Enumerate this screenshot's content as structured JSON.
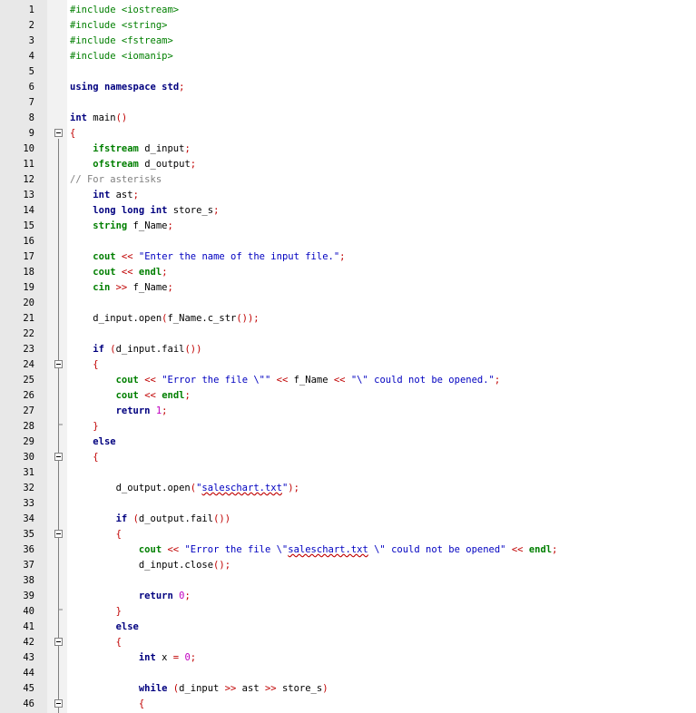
{
  "editor": {
    "lines": [
      {
        "n": "1",
        "fold": false,
        "tokens": [
          {
            "t": "#include <iostream>",
            "c": "pre"
          }
        ]
      },
      {
        "n": "2",
        "fold": false,
        "tokens": [
          {
            "t": "#include <string>",
            "c": "pre"
          }
        ]
      },
      {
        "n": "3",
        "fold": false,
        "tokens": [
          {
            "t": "#include <fstream>",
            "c": "pre"
          }
        ]
      },
      {
        "n": "4",
        "fold": false,
        "tokens": [
          {
            "t": "#include <iomanip>",
            "c": "pre"
          }
        ]
      },
      {
        "n": "5",
        "fold": false,
        "tokens": []
      },
      {
        "n": "6",
        "fold": false,
        "tokens": [
          {
            "t": "using",
            "c": "kw"
          },
          {
            "t": " "
          },
          {
            "t": "namespace",
            "c": "kw"
          },
          {
            "t": " "
          },
          {
            "t": "std",
            "c": "kw"
          },
          {
            "t": ";",
            "c": "op"
          }
        ]
      },
      {
        "n": "7",
        "fold": false,
        "tokens": []
      },
      {
        "n": "8",
        "fold": false,
        "tokens": [
          {
            "t": "int",
            "c": "kw"
          },
          {
            "t": " main"
          },
          {
            "t": "()",
            "c": "op"
          }
        ]
      },
      {
        "n": "9",
        "fold": true,
        "tokens": [
          {
            "t": "{",
            "c": "op"
          }
        ]
      },
      {
        "n": "10",
        "fold": false,
        "tokens": [
          {
            "t": "    "
          },
          {
            "t": "ifstream",
            "c": "green"
          },
          {
            "t": " d_input"
          },
          {
            "t": ";",
            "c": "op"
          }
        ]
      },
      {
        "n": "11",
        "fold": false,
        "tokens": [
          {
            "t": "    "
          },
          {
            "t": "ofstream",
            "c": "green"
          },
          {
            "t": " d_output"
          },
          {
            "t": ";",
            "c": "op"
          }
        ]
      },
      {
        "n": "12",
        "fold": false,
        "tokens": [
          {
            "t": "// For asterisks",
            "c": "cmt"
          }
        ]
      },
      {
        "n": "13",
        "fold": false,
        "tokens": [
          {
            "t": "    "
          },
          {
            "t": "int",
            "c": "kw"
          },
          {
            "t": " ast"
          },
          {
            "t": ";",
            "c": "op"
          }
        ]
      },
      {
        "n": "14",
        "fold": false,
        "tokens": [
          {
            "t": "    "
          },
          {
            "t": "long long int",
            "c": "kw"
          },
          {
            "t": " store_s"
          },
          {
            "t": ";",
            "c": "op"
          }
        ]
      },
      {
        "n": "15",
        "fold": false,
        "tokens": [
          {
            "t": "    "
          },
          {
            "t": "string",
            "c": "green"
          },
          {
            "t": " f_Name"
          },
          {
            "t": ";",
            "c": "op"
          }
        ]
      },
      {
        "n": "16",
        "fold": false,
        "tokens": []
      },
      {
        "n": "17",
        "fold": false,
        "tokens": [
          {
            "t": "    "
          },
          {
            "t": "cout",
            "c": "green"
          },
          {
            "t": " "
          },
          {
            "t": "<<",
            "c": "op"
          },
          {
            "t": " "
          },
          {
            "t": "\"Enter the name of the input file.\"",
            "c": "str"
          },
          {
            "t": ";",
            "c": "op"
          }
        ]
      },
      {
        "n": "18",
        "fold": false,
        "tokens": [
          {
            "t": "    "
          },
          {
            "t": "cout",
            "c": "green"
          },
          {
            "t": " "
          },
          {
            "t": "<<",
            "c": "op"
          },
          {
            "t": " "
          },
          {
            "t": "endl",
            "c": "green"
          },
          {
            "t": ";",
            "c": "op"
          }
        ]
      },
      {
        "n": "19",
        "fold": false,
        "tokens": [
          {
            "t": "    "
          },
          {
            "t": "cin",
            "c": "green"
          },
          {
            "t": " "
          },
          {
            "t": ">>",
            "c": "op"
          },
          {
            "t": " f_Name"
          },
          {
            "t": ";",
            "c": "op"
          }
        ]
      },
      {
        "n": "20",
        "fold": false,
        "tokens": []
      },
      {
        "n": "21",
        "fold": false,
        "tokens": [
          {
            "t": "    d_input.open"
          },
          {
            "t": "(",
            "c": "op"
          },
          {
            "t": "f_Name.c_str"
          },
          {
            "t": "());",
            "c": "op"
          }
        ]
      },
      {
        "n": "22",
        "fold": false,
        "tokens": []
      },
      {
        "n": "23",
        "fold": false,
        "tokens": [
          {
            "t": "    "
          },
          {
            "t": "if",
            "c": "kw"
          },
          {
            "t": " "
          },
          {
            "t": "(",
            "c": "op"
          },
          {
            "t": "d_input.fail"
          },
          {
            "t": "())",
            "c": "op"
          }
        ]
      },
      {
        "n": "24",
        "fold": true,
        "tokens": [
          {
            "t": "    "
          },
          {
            "t": "{",
            "c": "op"
          }
        ]
      },
      {
        "n": "25",
        "fold": false,
        "tokens": [
          {
            "t": "        "
          },
          {
            "t": "cout",
            "c": "green"
          },
          {
            "t": " "
          },
          {
            "t": "<<",
            "c": "op"
          },
          {
            "t": " "
          },
          {
            "t": "\"Error the file \\\"\"",
            "c": "str"
          },
          {
            "t": " "
          },
          {
            "t": "<<",
            "c": "op"
          },
          {
            "t": " f_Name "
          },
          {
            "t": "<<",
            "c": "op"
          },
          {
            "t": " "
          },
          {
            "t": "\"\\\" could not be opened.\"",
            "c": "str"
          },
          {
            "t": ";",
            "c": "op"
          }
        ]
      },
      {
        "n": "26",
        "fold": false,
        "tokens": [
          {
            "t": "        "
          },
          {
            "t": "cout",
            "c": "green"
          },
          {
            "t": " "
          },
          {
            "t": "<<",
            "c": "op"
          },
          {
            "t": " "
          },
          {
            "t": "endl",
            "c": "green"
          },
          {
            "t": ";",
            "c": "op"
          }
        ]
      },
      {
        "n": "27",
        "fold": false,
        "tokens": [
          {
            "t": "        "
          },
          {
            "t": "return",
            "c": "kw"
          },
          {
            "t": " "
          },
          {
            "t": "1",
            "c": "num"
          },
          {
            "t": ";",
            "c": "op"
          }
        ]
      },
      {
        "n": "28",
        "fold": false,
        "tokens": [
          {
            "t": "    "
          },
          {
            "t": "}",
            "c": "op"
          }
        ]
      },
      {
        "n": "29",
        "fold": false,
        "tokens": [
          {
            "t": "    "
          },
          {
            "t": "else",
            "c": "kw"
          }
        ]
      },
      {
        "n": "30",
        "fold": true,
        "tokens": [
          {
            "t": "    "
          },
          {
            "t": "{",
            "c": "op"
          }
        ]
      },
      {
        "n": "31",
        "fold": false,
        "tokens": []
      },
      {
        "n": "32",
        "fold": false,
        "tokens": [
          {
            "t": "        d_output.open"
          },
          {
            "t": "(",
            "c": "op"
          },
          {
            "t": "\"",
            "c": "str"
          },
          {
            "t": "saleschart.txt",
            "c": "str",
            "ul": true
          },
          {
            "t": "\"",
            "c": "str"
          },
          {
            "t": ");",
            "c": "op"
          }
        ]
      },
      {
        "n": "33",
        "fold": false,
        "tokens": []
      },
      {
        "n": "34",
        "fold": false,
        "tokens": [
          {
            "t": "        "
          },
          {
            "t": "if",
            "c": "kw"
          },
          {
            "t": " "
          },
          {
            "t": "(",
            "c": "op"
          },
          {
            "t": "d_output.fail"
          },
          {
            "t": "())",
            "c": "op"
          }
        ]
      },
      {
        "n": "35",
        "fold": true,
        "tokens": [
          {
            "t": "        "
          },
          {
            "t": "{",
            "c": "op"
          }
        ]
      },
      {
        "n": "36",
        "fold": false,
        "tokens": [
          {
            "t": "            "
          },
          {
            "t": "cout",
            "c": "green"
          },
          {
            "t": " "
          },
          {
            "t": "<<",
            "c": "op"
          },
          {
            "t": " "
          },
          {
            "t": "\"Error the file \\\"",
            "c": "str"
          },
          {
            "t": "saleschart.txt",
            "c": "str",
            "ul": true
          },
          {
            "t": " \\\" could not be opened\"",
            "c": "str"
          },
          {
            "t": " "
          },
          {
            "t": "<<",
            "c": "op"
          },
          {
            "t": " "
          },
          {
            "t": "endl",
            "c": "green"
          },
          {
            "t": ";",
            "c": "op"
          }
        ]
      },
      {
        "n": "37",
        "fold": false,
        "tokens": [
          {
            "t": "            d_input.close"
          },
          {
            "t": "();",
            "c": "op"
          }
        ]
      },
      {
        "n": "38",
        "fold": false,
        "tokens": []
      },
      {
        "n": "39",
        "fold": false,
        "tokens": [
          {
            "t": "            "
          },
          {
            "t": "return",
            "c": "kw"
          },
          {
            "t": " "
          },
          {
            "t": "0",
            "c": "num"
          },
          {
            "t": ";",
            "c": "op"
          }
        ]
      },
      {
        "n": "40",
        "fold": false,
        "tokens": [
          {
            "t": "        "
          },
          {
            "t": "}",
            "c": "op"
          }
        ]
      },
      {
        "n": "41",
        "fold": false,
        "tokens": [
          {
            "t": "        "
          },
          {
            "t": "else",
            "c": "kw"
          }
        ]
      },
      {
        "n": "42",
        "fold": true,
        "tokens": [
          {
            "t": "        "
          },
          {
            "t": "{",
            "c": "op"
          }
        ]
      },
      {
        "n": "43",
        "fold": false,
        "tokens": [
          {
            "t": "            "
          },
          {
            "t": "int",
            "c": "kw"
          },
          {
            "t": " x "
          },
          {
            "t": "=",
            "c": "op"
          },
          {
            "t": " "
          },
          {
            "t": "0",
            "c": "num"
          },
          {
            "t": ";",
            "c": "op"
          }
        ]
      },
      {
        "n": "44",
        "fold": false,
        "tokens": []
      },
      {
        "n": "45",
        "fold": false,
        "tokens": [
          {
            "t": "            "
          },
          {
            "t": "while",
            "c": "kw"
          },
          {
            "t": " "
          },
          {
            "t": "(",
            "c": "op"
          },
          {
            "t": "d_input "
          },
          {
            "t": ">>",
            "c": "op"
          },
          {
            "t": " ast "
          },
          {
            "t": ">>",
            "c": "op"
          },
          {
            "t": " store_s"
          },
          {
            "t": ")",
            "c": "op"
          }
        ]
      },
      {
        "n": "46",
        "fold": true,
        "tokens": [
          {
            "t": "            "
          },
          {
            "t": "{",
            "c": "op"
          }
        ]
      }
    ],
    "colors": {
      "keyword": "#00007f",
      "type": "#007f00",
      "preprocessor": "#007f00",
      "operator": "#c00000",
      "string": "#0000c0",
      "number": "#c000c0",
      "comment": "#808080",
      "gutter": "#e8e8e8"
    },
    "fold_icon": "minus-box-icon"
  }
}
